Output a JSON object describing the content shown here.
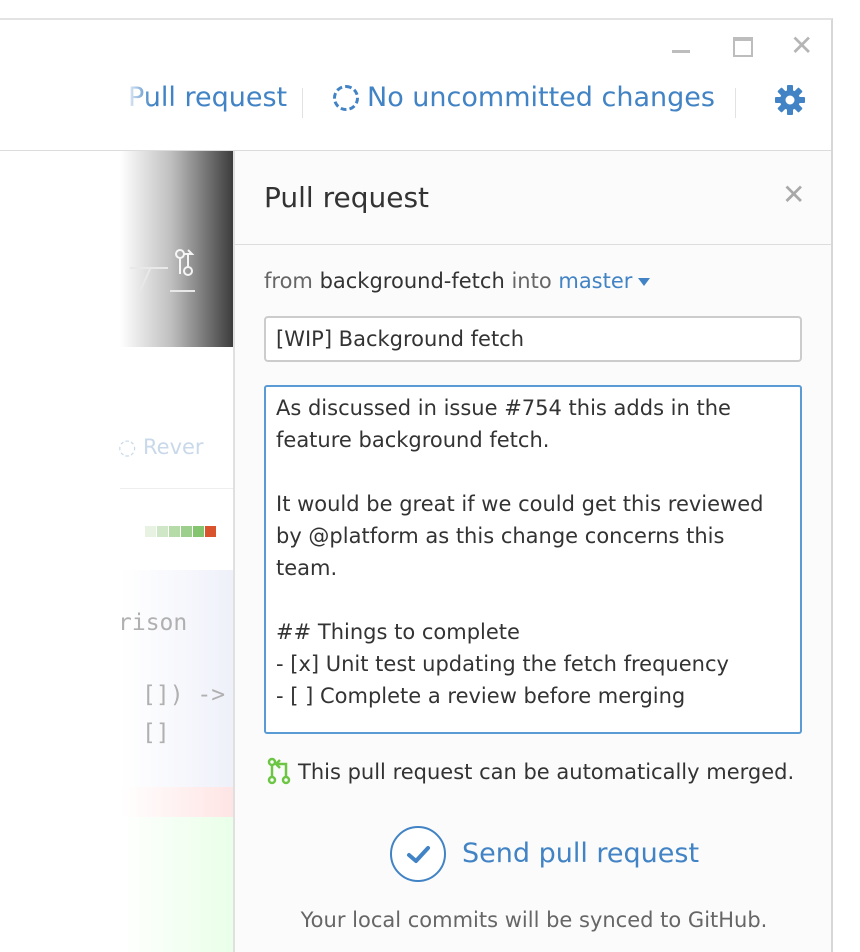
{
  "window": {
    "controls": [
      "minimize-icon",
      "maximize-icon",
      "close-icon"
    ]
  },
  "toolbar": {
    "pull_request_label": "Pull request",
    "sync_label": "No uncommitted changes",
    "sync_icon": "sync-icon",
    "settings_icon": "gear-icon"
  },
  "background": {
    "revert_label": "Rever",
    "code_fragment_1": "rison",
    "code_fragment_2": "[]) ->",
    "code_fragment_3": "[]"
  },
  "panel": {
    "title": "Pull request",
    "close_icon": "close-icon",
    "from_prefix": "from",
    "head_branch": "background-fetch",
    "into_word": "into",
    "base_branch": "master",
    "title_value": "[WIP] Background fetch",
    "body_value": "As discussed in issue #754 this adds in the feature background fetch.\n\nIt would be great if we could get this reviewed by @platform as this change concerns this team.\n\n## Things to complete\n- [x] Unit test updating the fetch frequency\n- [ ] Complete a review before merging",
    "merge_status": "This pull request can be automatically merged.",
    "merge_icon": "git-pull-request-icon",
    "send_label": "Send pull request",
    "send_icon": "check-icon",
    "sync_note": "Your local commits will be synced to GitHub."
  },
  "colors": {
    "accent": "#4183c4",
    "merge_green": "#6cc644",
    "diff_bars": [
      "#e7f2e2",
      "#cfe7c6",
      "#b5dba8",
      "#9ccf8b",
      "#83c46f",
      "#d9542c"
    ]
  }
}
